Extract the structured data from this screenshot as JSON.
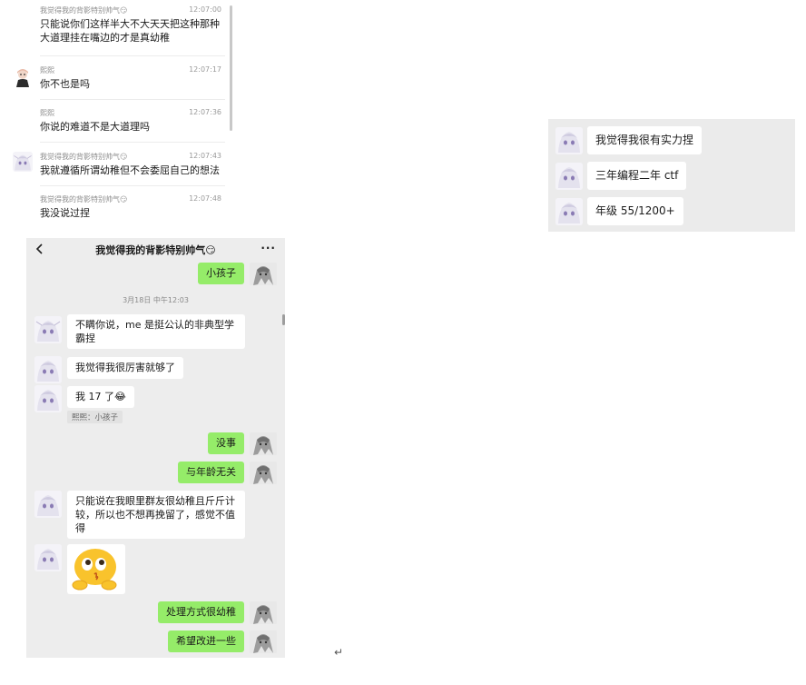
{
  "history": {
    "items": [
      {
        "sender": "我觉得我的背影特别帅气😏",
        "time": "12:07:00",
        "text": "只能说你们这样半大不大天天把这种那种大道理挂在嘴边的才是真幼稚",
        "avatar": "none"
      },
      {
        "sender": "熙熙",
        "time": "12:07:17",
        "text": "你不也是吗",
        "avatar": "chibi-avatar"
      },
      {
        "sender": "熙熙",
        "time": "12:07:36",
        "text": "你说的难道不是大道理吗",
        "avatar": "none"
      },
      {
        "sender": "我觉得我的背影特别帅气😏",
        "time": "12:07:43",
        "text": "我就遵循所谓幼稚但不会委屈自己的想法",
        "avatar": "anime-avatar"
      },
      {
        "sender": "我觉得我的背影特别帅气😏",
        "time": "12:07:48",
        "text": "我没说过捏",
        "avatar": "none"
      }
    ]
  },
  "chat": {
    "title": "我觉得我的背影特别帅气😏",
    "more": "···",
    "date_separator": "3月18日 中午12:03",
    "messages": [
      {
        "side": "self",
        "text": "小孩子"
      },
      {
        "side": "other",
        "text": "不瞒你说，me 是挺公认的非典型学霸捏"
      },
      {
        "side": "other",
        "text": "我觉得我很厉害就够了"
      },
      {
        "side": "other",
        "text": "我 17 了😂"
      },
      {
        "side": "quote",
        "text": "熙熙：小孩子"
      },
      {
        "side": "self",
        "text": "没事"
      },
      {
        "side": "self",
        "text": "与年龄无关"
      },
      {
        "side": "other",
        "text": "只能说在我眼里群友很幼稚且斤斤计较，所以也不想再挽留了，感觉不值得"
      },
      {
        "side": "other",
        "text": "[sticker]",
        "sticker": "thinking-emoji-sticker"
      },
      {
        "side": "self",
        "text": "处理方式很幼稚"
      },
      {
        "side": "self",
        "text": "希望改进一些"
      }
    ]
  },
  "right_panel": {
    "messages": [
      {
        "text": "我觉得我很有实力捏"
      },
      {
        "text": "三年编程二年 ctf"
      },
      {
        "text": "年级 55/1200+"
      }
    ]
  },
  "misc": {
    "return_glyph": "↵"
  },
  "colors": {
    "self_bubble": "#95ec69",
    "other_bubble": "#ffffff",
    "chat_background": "#ededed"
  }
}
